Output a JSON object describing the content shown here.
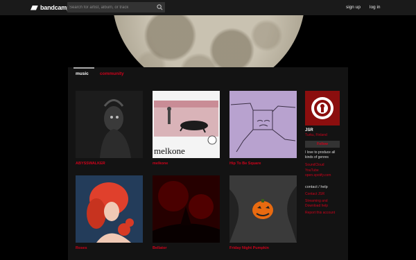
{
  "header": {
    "brand": "bandcamp",
    "search_placeholder": "Search for artist, album, or track",
    "signup": "sign up",
    "login": "log in"
  },
  "tabs": {
    "music": "music",
    "community": "community"
  },
  "releases": [
    {
      "title": "ABYSSWALKER"
    },
    {
      "title": "melkone",
      "cover_text": "melkone"
    },
    {
      "title": "Hip To Be Square"
    },
    {
      "title": "Roses"
    },
    {
      "title": "Bellator"
    },
    {
      "title": "Friday Night Pumpkin"
    }
  ],
  "artist": {
    "name": "JSR",
    "location": "Turku, Finland",
    "follow": "Follow",
    "bio": "I love to produce all kinds of genres",
    "links": [
      "SoundCloud",
      "YouTube",
      "open.spotify.com"
    ],
    "contact_heading": "contact / help",
    "contact_links": [
      "Contact JSR",
      "Streaming and Download help"
    ],
    "report": "Report this account"
  },
  "colors": {
    "accent": "#d0021b",
    "topbar": "#1a1a1a",
    "panel": "#131313"
  }
}
